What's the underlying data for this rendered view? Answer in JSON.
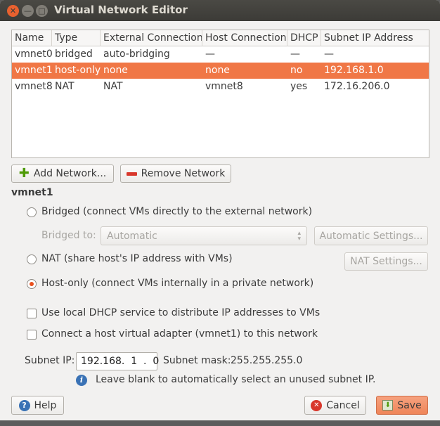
{
  "window": {
    "title": "Virtual Network Editor"
  },
  "table": {
    "columns": [
      "Name",
      "Type",
      "External Connection",
      "Host Connection",
      "DHCP",
      "Subnet IP Address"
    ],
    "rows": [
      [
        "vmnet0",
        "bridged",
        "auto-bridging",
        "—",
        "—",
        "—"
      ],
      [
        "vmnet1",
        "host-only",
        "none",
        "none",
        "no",
        "192.168.1.0"
      ],
      [
        "vmnet8",
        "NAT",
        "NAT",
        "vmnet8",
        "yes",
        "172.16.206.0"
      ]
    ],
    "selected_row": 1
  },
  "buttons": {
    "add_network": "Add Network...",
    "remove_network": "Remove Network",
    "automatic_settings": "Automatic Settings...",
    "nat_settings": "NAT Settings...",
    "help": "Help",
    "cancel": "Cancel",
    "save": "Save"
  },
  "section_title": "vmnet1",
  "options": {
    "bridged": "Bridged (connect VMs directly to the external network)",
    "bridged_to_label": "Bridged to:",
    "bridged_to_value": "Automatic",
    "nat": "NAT (share host's IP address with VMs)",
    "host_only": "Host-only (connect VMs internally in a private network)",
    "selected": "host_only",
    "dhcp": "Use local DHCP service to distribute IP addresses to VMs",
    "dhcp_checked": false,
    "adapter": "Connect a host virtual adapter (vmnet1) to this network",
    "adapter_checked": false
  },
  "subnet": {
    "ip_label": "Subnet IP:",
    "ip_value": "192.168.  1  .  0",
    "mask_label": "Subnet mask:",
    "mask_value": "255.255.255.0",
    "hint": "Leave blank to automatically select an unused subnet IP."
  },
  "colors": {
    "accent": "#f07746",
    "titlebar": "#3c3b37"
  }
}
